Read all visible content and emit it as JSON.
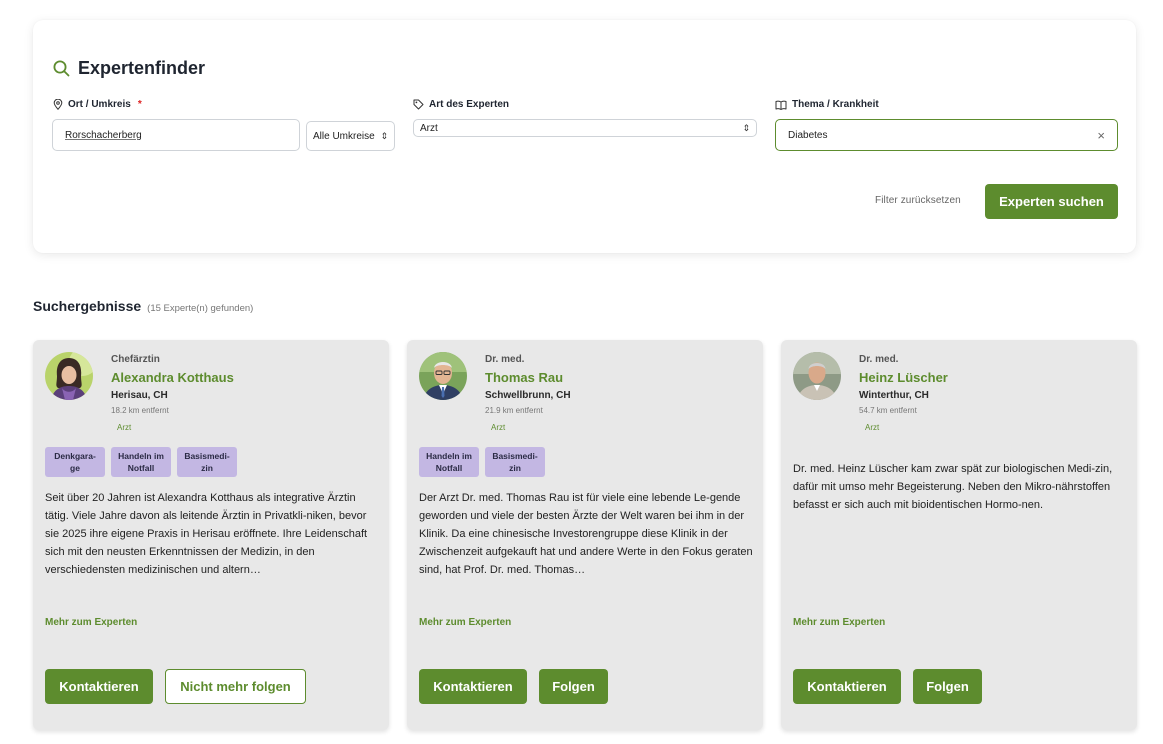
{
  "finder": {
    "title": "Expertenfinder",
    "location_label": "Ort / Umkreis",
    "required_mark": "*",
    "location_value": "Rorschacherberg",
    "radius_value": "Alle Umkreise",
    "type_label": "Art des Experten",
    "type_value": "Arzt",
    "topic_label": "Thema / Krankheit",
    "topic_value": "Diabetes",
    "reset_label": "Filter zurücksetzen",
    "search_label": "Experten suchen",
    "accent_color": "#5d8c2e"
  },
  "results": {
    "title": "Suchergebnisse",
    "count_text": "(15 Experte(n) gefunden)"
  },
  "cards": [
    {
      "title": "Chefärztin",
      "name": "Alexandra Kotthaus",
      "location": "Herisau, CH",
      "distance": "18.2 km entfernt",
      "type": "Arzt",
      "tags": [
        "Denkgara-\nge",
        "Handeln im\nNotfall",
        "Basismedi-\nzin"
      ],
      "description": "Seit über 20 Jahren ist Alexandra Kotthaus als integrative Ärztin tätig. Viele Jahre davon als leitende Ärztin in Privatkli-niken, bevor sie 2025 ihre eigene Praxis in Herisau eröffnete. Ihre Leidenschaft sich mit den neusten Erkenntnissen der Medizin, in den verschiedensten medizinischen und altern…",
      "more": "Mehr zum Experten",
      "contact": "Kontaktieren",
      "follow": "Nicht mehr folgen"
    },
    {
      "title": "Dr. med.",
      "name": "Thomas Rau",
      "location": "Schwellbrunn, CH",
      "distance": "21.9 km entfernt",
      "type": "Arzt",
      "tags": [
        "Handeln im\nNotfall",
        "Basismedi-\nzin"
      ],
      "description": "Der Arzt Dr. med. Thomas Rau ist für viele eine lebende Le-gende geworden und viele der besten Ärzte der Welt waren bei ihm in der Klinik. Da eine chinesische Investorengruppe diese Klinik in der Zwischenzeit aufgekauft hat und andere Werte in den Fokus geraten sind, hat Prof. Dr. med. Thomas…",
      "more": "Mehr zum Experten",
      "contact": "Kontaktieren",
      "follow": "Folgen"
    },
    {
      "title": "Dr. med.",
      "name": "Heinz Lüscher",
      "location": "Winterthur, CH",
      "distance": "54.7 km entfernt",
      "type": "Arzt",
      "tags": [],
      "description": "Dr. med. Heinz Lüscher kam zwar spät zur biologischen Medi-zin, dafür mit umso mehr Begeisterung. Neben den Mikro-nährstoffen befasst er sich auch mit bioidentischen Hormo-nen.",
      "more": "Mehr zum Experten",
      "contact": "Kontaktieren",
      "follow": "Folgen"
    }
  ]
}
